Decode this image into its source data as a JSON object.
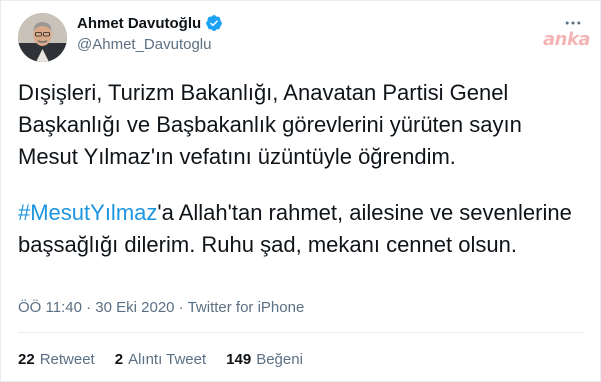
{
  "author": {
    "name": "Ahmet Davutoğlu",
    "handle": "@Ahmet_Davutoglu",
    "verified": true
  },
  "watermark": "anka",
  "tweet": {
    "paragraph1": "Dışişleri, Turizm Bakanlığı, Anavatan Partisi Genel Başkanlığı ve Başbakanlık görevlerini yürüten sayın Mesut Yılmaz'ın vefatını üzüntüyle öğrendim.",
    "hashtag": "#MesutYılmaz",
    "paragraph2_rest": "'a Allah'tan rahmet, ailesine ve sevenlerine başsağlığı dilerim. Ruhu şad, mekanı cennet olsun."
  },
  "meta": {
    "time": "ÖÖ 11:40",
    "separator1": " · ",
    "date": "30 Eki 2020",
    "separator2": " · ",
    "source": "Twitter for iPhone"
  },
  "stats": {
    "retweets_count": "22",
    "retweets_label": "Retweet",
    "quotes_count": "2",
    "quotes_label": "Alıntı Tweet",
    "likes_count": "149",
    "likes_label": "Beğeni"
  },
  "colors": {
    "link": "#1b95e0",
    "verified": "#1da1f2",
    "secondary_text": "#5b7083",
    "watermark": "#f3b5b5"
  },
  "icons": {
    "verified": "verified-badge-icon",
    "more": "more-options-icon"
  }
}
